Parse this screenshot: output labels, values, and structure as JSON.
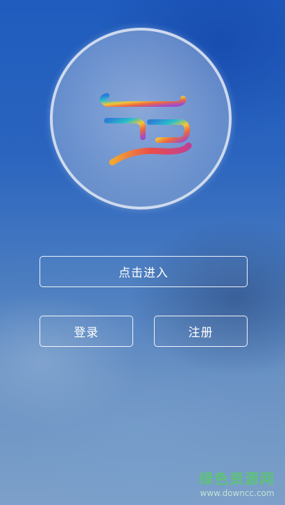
{
  "logo": {
    "icon": "app-logo-icon",
    "colors": [
      "#2bb7c9",
      "#f2c23a",
      "#ea5b4b",
      "#a14bc7",
      "#3a8fd8"
    ]
  },
  "actions": {
    "enter_label": "点击进入",
    "login_label": "登录",
    "register_label": "注册"
  },
  "watermark": {
    "title": "绿色资源网",
    "url": "www.downcc.com"
  }
}
